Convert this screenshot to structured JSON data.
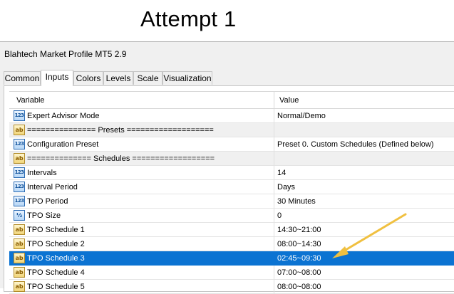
{
  "heading": "Attempt 1",
  "window_title": "Blahtech Market Profile MT5 2.9",
  "tabs": [
    {
      "label": "Common",
      "active": false
    },
    {
      "label": "Inputs",
      "active": true
    },
    {
      "label": "Colors",
      "active": false
    },
    {
      "label": "Levels",
      "active": false
    },
    {
      "label": "Scale",
      "active": false
    },
    {
      "label": "Visualization",
      "active": false
    }
  ],
  "table": {
    "col_variable": "Variable",
    "col_value": "Value",
    "rows": [
      {
        "icon": "number-icon",
        "icon_text": "123",
        "variable": "Expert Advisor Mode",
        "value": "Normal/Demo",
        "separator": false,
        "selected": false
      },
      {
        "icon": "text-icon",
        "icon_text": "ab",
        "variable": "=============== Presets ===================",
        "value": "",
        "separator": true,
        "selected": false
      },
      {
        "icon": "number-icon",
        "icon_text": "123",
        "variable": "Configuration Preset",
        "value": "Preset 0. Custom Schedules (Defined below)",
        "separator": false,
        "selected": false
      },
      {
        "icon": "text-icon",
        "icon_text": "ab",
        "variable": "============== Schedules ==================",
        "value": "",
        "separator": true,
        "selected": false
      },
      {
        "icon": "number-icon",
        "icon_text": "123",
        "variable": "Intervals",
        "value": "14",
        "separator": false,
        "selected": false
      },
      {
        "icon": "number-icon",
        "icon_text": "123",
        "variable": "Interval Period",
        "value": "Days",
        "separator": false,
        "selected": false
      },
      {
        "icon": "number-icon",
        "icon_text": "123",
        "variable": "TPO Period",
        "value": "30 Minutes",
        "separator": false,
        "selected": false
      },
      {
        "icon": "fraction-icon",
        "icon_text": "½",
        "variable": "TPO Size",
        "value": "0",
        "separator": false,
        "selected": false
      },
      {
        "icon": "text-icon",
        "icon_text": "ab",
        "variable": "TPO Schedule 1",
        "value": "14:30~21:00",
        "separator": false,
        "selected": false
      },
      {
        "icon": "text-icon",
        "icon_text": "ab",
        "variable": "TPO Schedule 2",
        "value": "08:00~14:30",
        "separator": false,
        "selected": false
      },
      {
        "icon": "text-icon",
        "icon_text": "ab",
        "variable": "TPO Schedule 3",
        "value": "02:45~09:30",
        "separator": false,
        "selected": true
      },
      {
        "icon": "text-icon",
        "icon_text": "ab",
        "variable": "TPO Schedule 4",
        "value": "07:00~08:00",
        "separator": false,
        "selected": false
      },
      {
        "icon": "text-icon",
        "icon_text": "ab",
        "variable": "TPO Schedule 5",
        "value": "08:00~08:00",
        "separator": false,
        "selected": false
      }
    ]
  },
  "colors": {
    "selection": "#0b73d2",
    "annotation_arrow": "#f0c040"
  }
}
